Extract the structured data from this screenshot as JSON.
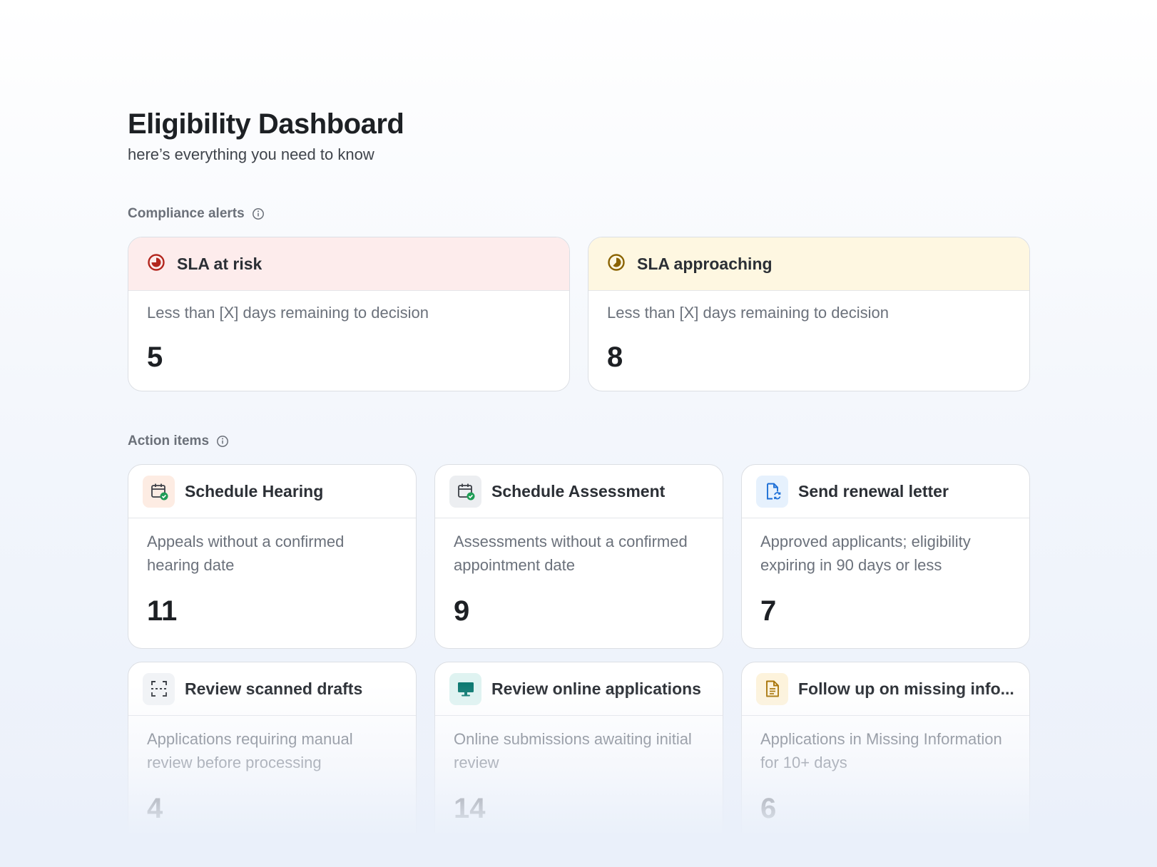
{
  "header": {
    "title": "Eligibility Dashboard",
    "subtitle": "here’s everything you need to know"
  },
  "compliance": {
    "label": "Compliance alerts",
    "info_icon": "info-icon",
    "alerts": [
      {
        "title": "SLA at risk",
        "description": "Less than [X] days remaining to decision",
        "value": "5",
        "icon": "timer-icon",
        "color": "#b3261e",
        "header_bg": "#fdecec"
      },
      {
        "title": "SLA approaching",
        "description": "Less than [X] days remaining to decision",
        "value": "8",
        "icon": "timer-icon",
        "color": "#8a6300",
        "header_bg": "#fef7e1"
      }
    ]
  },
  "actions": {
    "label": "Action items",
    "info_icon": "info-icon",
    "items": [
      {
        "title": "Schedule Hearing",
        "description": "Appeals without a confirmed hearing date",
        "value": "11",
        "icon": "calendar-check-icon"
      },
      {
        "title": "Schedule Assessment",
        "description": "Assessments without a confirmed appointment date",
        "value": "9",
        "icon": "calendar-check-icon"
      },
      {
        "title": "Send renewal letter",
        "description": "Approved applicants; eligibility expiring in 90 days or less",
        "value": "7",
        "icon": "document-refresh-icon"
      },
      {
        "title": "Review scanned drafts",
        "description": "Applications requiring manual review before processing",
        "value": "4",
        "icon": "scan-icon"
      },
      {
        "title": "Review online applications",
        "description": "Online submissions awaiting initial review",
        "value": "14",
        "icon": "monitor-icon"
      },
      {
        "title": "Follow up on missing info...",
        "description": "Applications in Missing Information for 10+ days",
        "value": "6",
        "icon": "document-lines-icon"
      }
    ]
  },
  "colors": {
    "success_green": "#1f9d55",
    "blue_icon": "#1d6fd6",
    "teal_icon": "#0f7a72",
    "amber_icon": "#a9760a"
  }
}
